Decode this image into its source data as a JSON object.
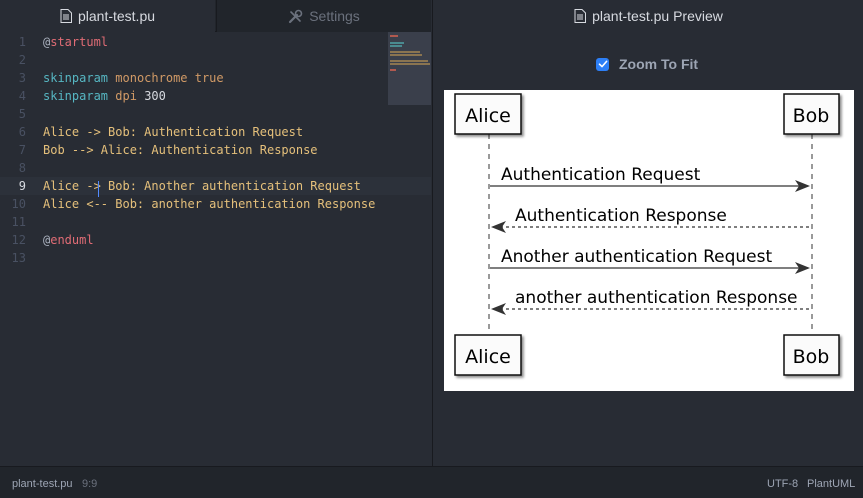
{
  "editor_tab": {
    "file_name": "plant-test.pu",
    "settings_label": "Settings"
  },
  "editor": {
    "line_numbers": [
      "1",
      "2",
      "3",
      "4",
      "5",
      "6",
      "7",
      "8",
      "9",
      "10",
      "11",
      "12",
      "13"
    ],
    "active_line": "9",
    "code": {
      "l1_at": "@",
      "l1_kw": "startuml",
      "l3_fn": "skinparam",
      "l3_val": "monochrome true",
      "l4_fn": "skinparam",
      "l4_val": "dpi",
      "l4_num": "300",
      "l6": "Alice -> Bob: Authentication Request",
      "l7": "Bob --> Alice: Authentication Response",
      "l9": "Alice -> Bob: Another authentication Request",
      "l10": "Alice <-- Bob: another authentication Response",
      "l12_at": "@",
      "l12_kw": "enduml"
    }
  },
  "preview": {
    "title": "plant-test.pu Preview",
    "zoom_to_fit_label": "Zoom To Fit",
    "zoom_to_fit_checked": true
  },
  "diagram": {
    "participants": [
      "Alice",
      "Bob"
    ],
    "messages": [
      {
        "from": "Alice",
        "to": "Bob",
        "text": "Authentication Request",
        "dashed": false
      },
      {
        "from": "Bob",
        "to": "Alice",
        "text": "Authentication Response",
        "dashed": true
      },
      {
        "from": "Alice",
        "to": "Bob",
        "text": "Another authentication Request",
        "dashed": false
      },
      {
        "from": "Bob",
        "to": "Alice",
        "text": "another authentication Response",
        "dashed": true
      }
    ]
  },
  "status_bar": {
    "file_name": "plant-test.pu",
    "cursor_position": "9:9",
    "encoding": "UTF-8",
    "grammar": "PlantUML"
  },
  "colors": {
    "background": "#282c34",
    "panel": "#21252b",
    "accent": "#2d7ff6",
    "keyword": "#e06c75",
    "function": "#56b6c2",
    "string": "#e5c07b"
  },
  "icons": {
    "file_tab": "file-icon",
    "settings_tab": "tools-icon",
    "preview": "file-icon"
  }
}
